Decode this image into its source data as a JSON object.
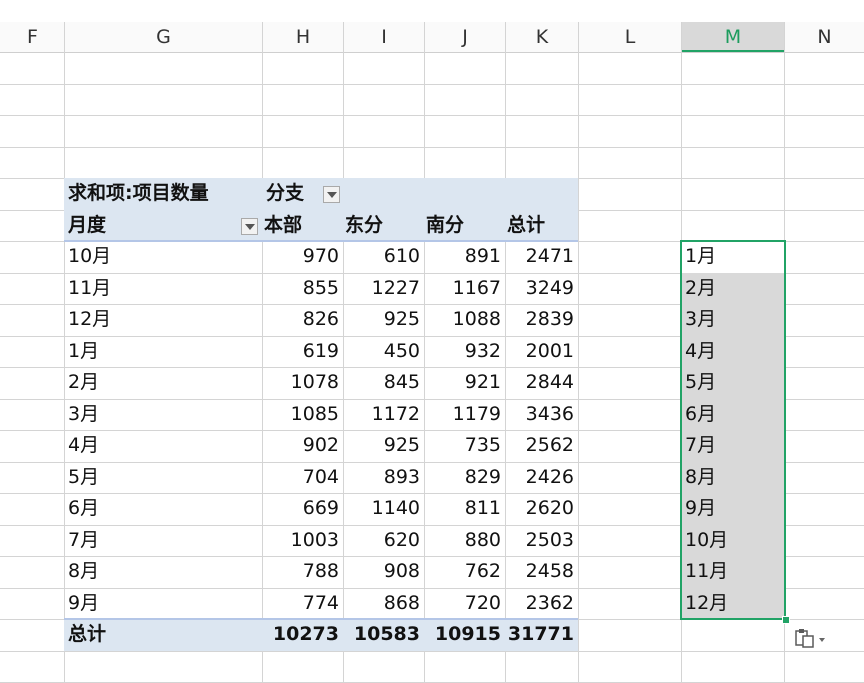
{
  "columns": [
    "F",
    "G",
    "H",
    "I",
    "J",
    "K",
    "L",
    "M",
    "N"
  ],
  "active_column": "M",
  "pivot": {
    "header_label": "求和项:项目数量",
    "column_field": "分支",
    "row_field": "月度",
    "series": [
      "本部",
      "东分",
      "南分",
      "总计"
    ],
    "rows": [
      {
        "label": "10月",
        "values": [
          "970",
          "610",
          "891",
          "2471"
        ]
      },
      {
        "label": "11月",
        "values": [
          "855",
          "1227",
          "1167",
          "3249"
        ]
      },
      {
        "label": "12月",
        "values": [
          "826",
          "925",
          "1088",
          "2839"
        ]
      },
      {
        "label": "1月",
        "values": [
          "619",
          "450",
          "932",
          "2001"
        ]
      },
      {
        "label": "2月",
        "values": [
          "1078",
          "845",
          "921",
          "2844"
        ]
      },
      {
        "label": "3月",
        "values": [
          "1085",
          "1172",
          "1179",
          "3436"
        ]
      },
      {
        "label": "4月",
        "values": [
          "902",
          "925",
          "735",
          "2562"
        ]
      },
      {
        "label": "5月",
        "values": [
          "704",
          "893",
          "829",
          "2426"
        ]
      },
      {
        "label": "6月",
        "values": [
          "669",
          "1140",
          "811",
          "2620"
        ]
      },
      {
        "label": "7月",
        "values": [
          "1003",
          "620",
          "880",
          "2503"
        ]
      },
      {
        "label": "8月",
        "values": [
          "788",
          "908",
          "762",
          "2458"
        ]
      },
      {
        "label": "9月",
        "values": [
          "774",
          "868",
          "720",
          "2362"
        ]
      }
    ],
    "total": {
      "label": "总计",
      "values": [
        "10273",
        "10583",
        "10915",
        "31771"
      ]
    }
  },
  "m_column": [
    "1月",
    "2月",
    "3月",
    "4月",
    "5月",
    "6月",
    "7月",
    "8月",
    "9月",
    "10月",
    "11月",
    "12月"
  ],
  "colors": {
    "accent": "#21a366",
    "pivot_band": "#dce6f1",
    "selection_fill": "#d9d9d9"
  },
  "icons": {
    "paste_options": "paste-options-icon",
    "filter_dropdown": "chevron-down-icon"
  }
}
